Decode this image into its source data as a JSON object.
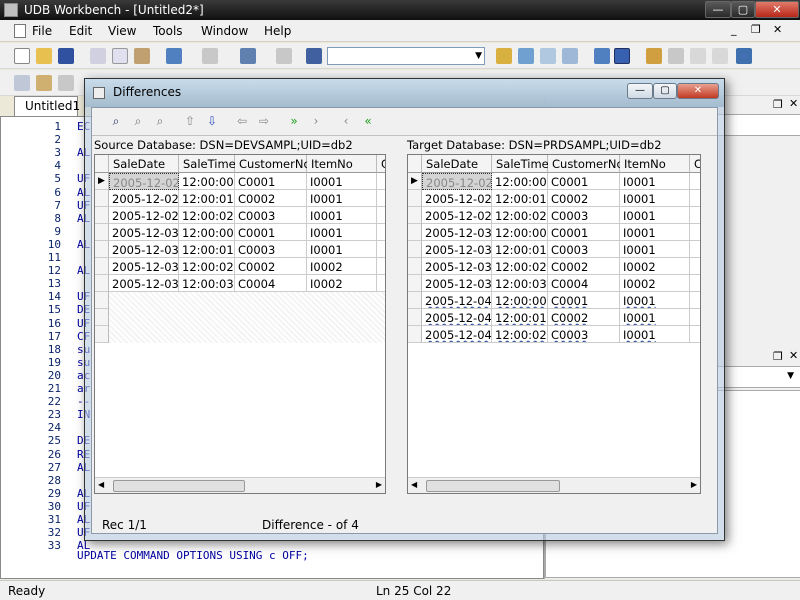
{
  "app": {
    "title": "UDB Workbench - [Untitled2*]",
    "window_controls": {
      "minimize": "—",
      "maximize": "▢",
      "close": "✕"
    }
  },
  "menu": {
    "items": [
      "File",
      "Edit",
      "View",
      "Tools",
      "Window",
      "Help"
    ],
    "mdi_controls": {
      "minimize": "_",
      "restore": "❐",
      "close": "✕"
    }
  },
  "editor": {
    "tab_label": "Untitled1",
    "line_numbers": [
      "1",
      "2",
      "3",
      "4",
      "5",
      "6",
      "7",
      "8",
      "9",
      "10",
      "11",
      "12",
      "13",
      "14",
      "15",
      "16",
      "17",
      "18",
      "19",
      "20",
      "21",
      "22",
      "23",
      "24",
      "25",
      "26",
      "27",
      "28",
      "29",
      "30",
      "31",
      "32",
      "33"
    ],
    "visible_fragments": {
      "1": "EC",
      "3": "AL",
      "5": "UF",
      "6": "AL",
      "7": "UF",
      "8": "AL",
      "10": "AL",
      "12": "AL",
      "14": "UF",
      "15": "DE",
      "16": "UF",
      "17": "CF",
      "18": "su",
      "19": "su",
      "20": "ac",
      "21": "ar",
      "22": "--",
      "23": "IN",
      "25": "DE",
      "26": "RE",
      "27": "AL",
      "29": "AL",
      "30": "UF",
      "31": "AL",
      "32": "UF",
      "33": "AL"
    },
    "bottom_line": "UPDATE COMMAND OPTIONS USING c OFF;"
  },
  "status": {
    "ready": "Ready",
    "position": "Ln 25  Col 22"
  },
  "dialog": {
    "title": "Differences",
    "controls": {
      "minimize": "—",
      "maximize": "▢",
      "close": "✕"
    },
    "source_label": "Source Database: DSN=DEVSAMPL;UID=db2",
    "target_label": "Target Database: DSN=PRDSAMPL;UID=db2",
    "columns": [
      "SaleDate",
      "SaleTime",
      "CustomerNo",
      "ItemNo",
      "C"
    ],
    "source_rows": [
      [
        "2005-12-02",
        "12:00:00",
        "C0001",
        "I0001"
      ],
      [
        "2005-12-02",
        "12:00:01",
        "C0002",
        "I0001"
      ],
      [
        "2005-12-02",
        "12:00:02",
        "C0003",
        "I0001"
      ],
      [
        "2005-12-03",
        "12:00:00",
        "C0001",
        "I0001"
      ],
      [
        "2005-12-03",
        "12:00:01",
        "C0003",
        "I0001"
      ],
      [
        "2005-12-03",
        "12:00:02",
        "C0002",
        "I0002"
      ],
      [
        "2005-12-03",
        "12:00:03",
        "C0004",
        "I0002"
      ]
    ],
    "target_rows": [
      [
        "2005-12-02",
        "12:00:00",
        "C0001",
        "I0001"
      ],
      [
        "2005-12-02",
        "12:00:01",
        "C0002",
        "I0001"
      ],
      [
        "2005-12-02",
        "12:00:02",
        "C0003",
        "I0001"
      ],
      [
        "2005-12-03",
        "12:00:00",
        "C0001",
        "I0001"
      ],
      [
        "2005-12-03",
        "12:00:01",
        "C0003",
        "I0001"
      ],
      [
        "2005-12-03",
        "12:00:02",
        "C0002",
        "I0002"
      ],
      [
        "2005-12-03",
        "12:00:03",
        "C0004",
        "I0002"
      ],
      [
        "2005-12-04",
        "12:00:00",
        "C0001",
        "I0001"
      ],
      [
        "2005-12-04",
        "12:00:01",
        "C0002",
        "I0001"
      ],
      [
        "2005-12-04",
        "12:00:02",
        "C0003",
        "I0001"
      ]
    ],
    "status_rec": "Rec 1/1",
    "status_diff": "Difference - of 4"
  }
}
